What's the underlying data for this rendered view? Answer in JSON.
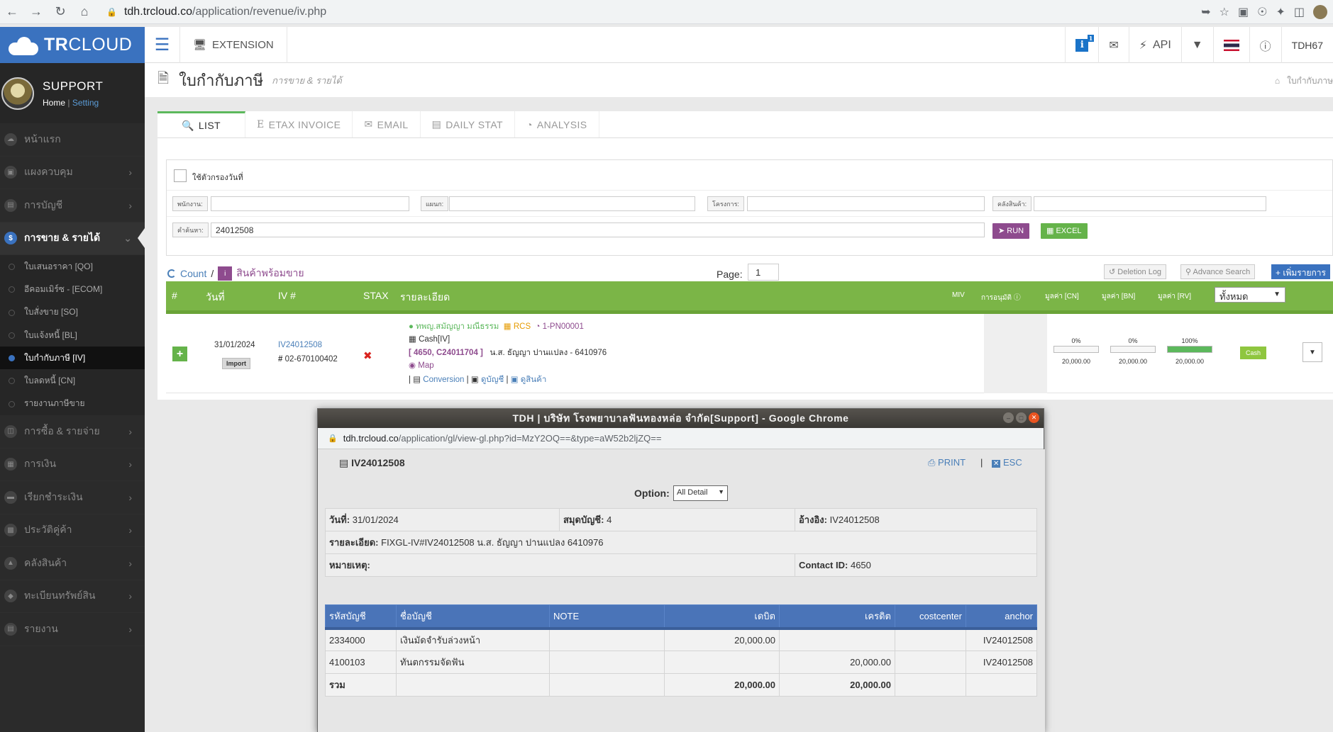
{
  "browser": {
    "url_host": "tdh.trcloud.co",
    "url_path": "/application/revenue/iv.php"
  },
  "header": {
    "logo_bold": "TR",
    "logo_light": "CLOUD",
    "extension_label": "EXTENSION",
    "info_count": "1",
    "api_label": "API",
    "user_name": "TDH67"
  },
  "sidebar": {
    "profile_name": "SUPPORT",
    "home_link": "Home",
    "separator": "|",
    "setting_link": "Setting",
    "items": [
      {
        "label": "หน้าแรก",
        "icon": "cloud-icon"
      },
      {
        "label": "แผงควบคุม",
        "icon": "monitor-icon"
      },
      {
        "label": "การบัญชี",
        "icon": "book-icon"
      },
      {
        "label": "การขาย & รายได้",
        "icon": "dollar-icon"
      },
      {
        "label": "การซื้อ & รายจ่าย",
        "icon": "cart-icon"
      },
      {
        "label": "การเงิน",
        "icon": "calendar-icon"
      },
      {
        "label": "เรียกชำระเงิน",
        "icon": "card-icon"
      },
      {
        "label": "ประวัติคู่ค้า",
        "icon": "contact-icon"
      },
      {
        "label": "คลังสินค้า",
        "icon": "warehouse-icon"
      },
      {
        "label": "ทะเบียนทรัพย์สิน",
        "icon": "diamond-icon"
      },
      {
        "label": "รายงาน",
        "icon": "report-icon"
      }
    ],
    "submenu": [
      "ใบเสนอราคา [QO]",
      "อีคอมเมิร์ซ - [ECOM]",
      "ใบสั่งขาย [SO]",
      "ใบแจ้งหนี้ [BL]",
      "ใบกำกับภาษี [IV]",
      "ใบลดหนี้ [CN]",
      "รายงานภาษีขาย"
    ]
  },
  "page": {
    "title": "ใบกำกับภาษี",
    "subtitle": "การขาย & รายได้",
    "breadcrumb": "ใบกำกับภาษ"
  },
  "tabs": [
    "LIST",
    "ETAX INVOICE",
    "EMAIL",
    "DAILY STAT",
    "ANALYSIS"
  ],
  "filters": {
    "date_filter_label": "ใช้ตัวกรองวันที่",
    "employee_label": "พนักงาน:",
    "department_label": "แผนก:",
    "project_label": "โครงการ:",
    "warehouse_label": "คลังสินค้า:",
    "search_label": "คำค้นหา:",
    "search_value": "24012508",
    "run_label": "RUN",
    "excel_label": "EXCEL"
  },
  "list_toolbar": {
    "count_label": "Count",
    "slash": "/",
    "stock_label": "สินค้าพร้อมขาย",
    "page_label": "Page:",
    "page_value": "1",
    "deletion_log": "Deletion Log",
    "advance_search": "Advance Search",
    "add_label": "เพิ่มรายการ"
  },
  "grid_headers": {
    "num": "#",
    "date": "วันที่",
    "iv": "IV #",
    "stax": "STAX",
    "detail": "รายละเอียด",
    "miv": "MIV",
    "approve": "การอนุมัติ",
    "val_cn": "มูลค่า [CN]",
    "val_bn": "มูลค่า [BN]",
    "val_rv": "มูลค่า [RV]",
    "filter_select": "ทั้งหมด"
  },
  "grid_row": {
    "date": "31/01/2024",
    "import_badge": "Import",
    "iv_number": "IV24012508",
    "hash": "#",
    "ref_number": "02-670100402",
    "contact": "ทพญ.สมัญญา มณีธรรม",
    "rcs": "RCS",
    "project_code": "1-PN00001",
    "payment": "Cash[IV]",
    "refs": "[ 4650, C24011704 ]",
    "customer": "น.ส. ธัญญา ปานแปลง - 6410976",
    "map": "Map",
    "conversion": "Conversion",
    "view_gl": "ดูบัญชี",
    "view_product": "ดูสินค้า",
    "sep": "|",
    "cn_pct": "0%",
    "cn_fraction": 0,
    "cn_value": "20,000.00",
    "bn_pct": "0%",
    "bn_fraction": 0,
    "bn_value": "20,000.00",
    "rv_pct": "100%",
    "rv_fraction": 1,
    "rv_value": "20,000.00",
    "status": "Cash"
  },
  "popup": {
    "title": "TDH | บริษัท โรงพยาบาลฟันทองหล่อ จำกัด[Support] - Google Chrome",
    "url_host": "tdh.trcloud.co",
    "url_path": "/application/gl/view-gl.php?id=MzY2OQ==&type=aW52b2ljZQ==",
    "doc_number": "IV24012508",
    "print_label": "PRINT",
    "esc_label": "ESC",
    "sep": "|",
    "option_label": "Option:",
    "option_value": "All Detail",
    "date_label": "วันที่:",
    "date_value": "31/01/2024",
    "book_label": "สมุดบัญชี:",
    "book_value": "4",
    "ref_label": "อ้างอิง:",
    "ref_value": "IV24012508",
    "detail_label": "รายละเอียด:",
    "detail_value": "FIXGL-IV#IV24012508 น.ส. ธัญญา ปานแปลง 6410976",
    "note_label": "หมายเหตุ:",
    "contact_label": "Contact ID:",
    "contact_value": "4650",
    "gl_headers": [
      "รหัสบัญชี",
      "ชื่อบัญชี",
      "NOTE",
      "เดบิต",
      "เครดิต",
      "costcenter",
      "anchor"
    ],
    "gl_rows": [
      [
        "2334000",
        "เงินมัดจำรับล่วงหน้า",
        "",
        "20,000.00",
        "",
        "",
        "IV24012508"
      ],
      [
        "4100103",
        "ทันตกรรมจัดฟัน",
        "",
        "",
        "20,000.00",
        "",
        "IV24012508"
      ]
    ],
    "total_label": "รวม",
    "total_debit": "20,000.00",
    "total_credit": "20,000.00"
  }
}
